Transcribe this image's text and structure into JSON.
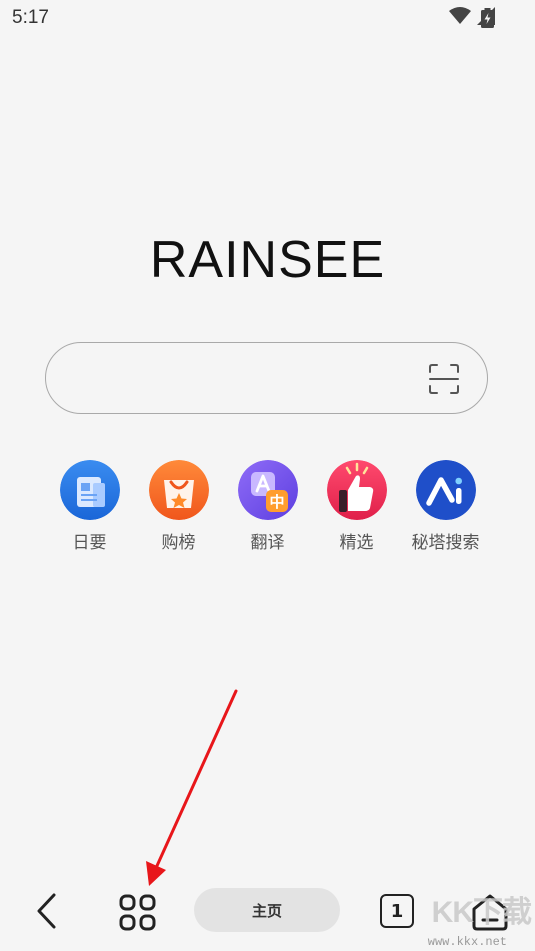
{
  "status": {
    "time": "5:17"
  },
  "brand": {
    "logo_text": "RAINSEE"
  },
  "search": {
    "placeholder": ""
  },
  "shortcuts": [
    {
      "label": "日要",
      "icon": "news-icon",
      "color": "#2f7fe8"
    },
    {
      "label": "购榜",
      "icon": "shopping-bag-icon",
      "color": "#f26a2b"
    },
    {
      "label": "翻译",
      "icon": "translate-icon",
      "color": "#7a5cf0"
    },
    {
      "label": "精选",
      "icon": "thumbs-up-icon",
      "color": "#f0365a"
    },
    {
      "label": "秘塔搜索",
      "icon": "metaso-icon",
      "color": "#1f4fc9"
    }
  ],
  "translate_badge": "中",
  "toolbar": {
    "home_label": "主页",
    "tab_count": "1"
  },
  "watermark": {
    "text": "KK下载",
    "url": "www.kkx.net"
  },
  "annotation": {
    "arrow_color": "#e8161a"
  }
}
